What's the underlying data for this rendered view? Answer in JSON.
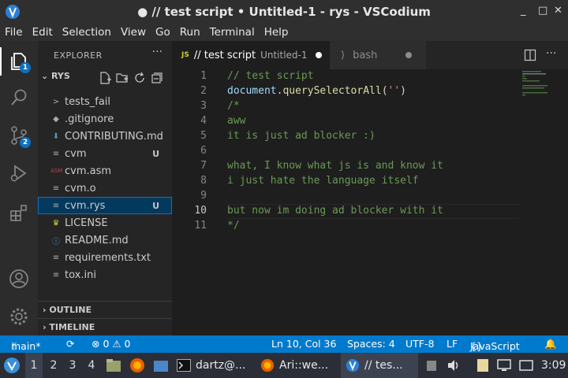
{
  "window": {
    "title": "● // test script • Untitled-1 - rys - VSCodium",
    "controls": [
      "_",
      "□",
      "✕"
    ]
  },
  "menu": [
    "File",
    "Edit",
    "Selection",
    "View",
    "Go",
    "Run",
    "Terminal",
    "Help"
  ],
  "activity": {
    "explorer_badge": "1",
    "scm_badge": "2"
  },
  "sidebar": {
    "header": "EXPLORER",
    "more": "···",
    "folder": "RYS",
    "files": [
      {
        "name": "tests_fail",
        "icon": ">",
        "status": ""
      },
      {
        "name": ".gitignore",
        "icon": "◆",
        "status": ""
      },
      {
        "name": "CONTRIBUTING.md",
        "icon": "⬇",
        "status": ""
      },
      {
        "name": "cvm",
        "icon": "≡",
        "status": "U"
      },
      {
        "name": "cvm.asm",
        "icon": "ASM",
        "status": ""
      },
      {
        "name": "cvm.o",
        "icon": "≡",
        "status": ""
      },
      {
        "name": "cvm.rys",
        "icon": "≡",
        "status": "U"
      },
      {
        "name": "LICENSE",
        "icon": "♛",
        "status": ""
      },
      {
        "name": "README.md",
        "icon": "ⓘ",
        "status": ""
      },
      {
        "name": "requirements.txt",
        "icon": "≡",
        "status": ""
      },
      {
        "name": "tox.ini",
        "icon": "≡",
        "status": ""
      }
    ],
    "outline": "OUTLINE",
    "timeline": "TIMELINE"
  },
  "tabs": [
    {
      "lang": "JS",
      "label": "// test script",
      "file": "Untitled-1"
    },
    {
      "label": "bash"
    }
  ],
  "editor": {
    "lines": [
      {
        "n": "1",
        "text": "// test script"
      },
      {
        "n": "2",
        "text": "document.querySelectorAll('')"
      },
      {
        "n": "3",
        "text": "/*"
      },
      {
        "n": "4",
        "text": "aww"
      },
      {
        "n": "5",
        "text": "it is just ad blocker :)"
      },
      {
        "n": "6",
        "text": ""
      },
      {
        "n": "7",
        "text": "what, I know what js is and know it"
      },
      {
        "n": "8",
        "text": "i just hate the language itself"
      },
      {
        "n": "9",
        "text": ""
      },
      {
        "n": "10",
        "text": "but now im doing ad blocker with it"
      },
      {
        "n": "11",
        "text": "*/"
      }
    ],
    "line2": {
      "obj": "document",
      "dot": ".",
      "fn": "querySelectorAll",
      "open": "(",
      "str": "''",
      "close": ")"
    }
  },
  "status": {
    "branch": "main*",
    "problems": "⊗ 0 ⚠ 0",
    "position": "Ln 10, Col 36",
    "spaces": "Spaces: 4",
    "encoding": "UTF-8",
    "eol": "LF",
    "language": "JavaScript"
  },
  "taskbar": {
    "workspaces": [
      "1",
      "2",
      "3",
      "4"
    ],
    "items": [
      {
        "label": "dartz@..."
      },
      {
        "label": "Ari::we..."
      },
      {
        "label": "// tes..."
      }
    ],
    "clock": "3:09"
  },
  "colors": {
    "accent": "#007acc",
    "comment": "#6a9955",
    "function": "#dcdcaa",
    "string": "#ce9178",
    "variable": "#9cdcfe"
  }
}
